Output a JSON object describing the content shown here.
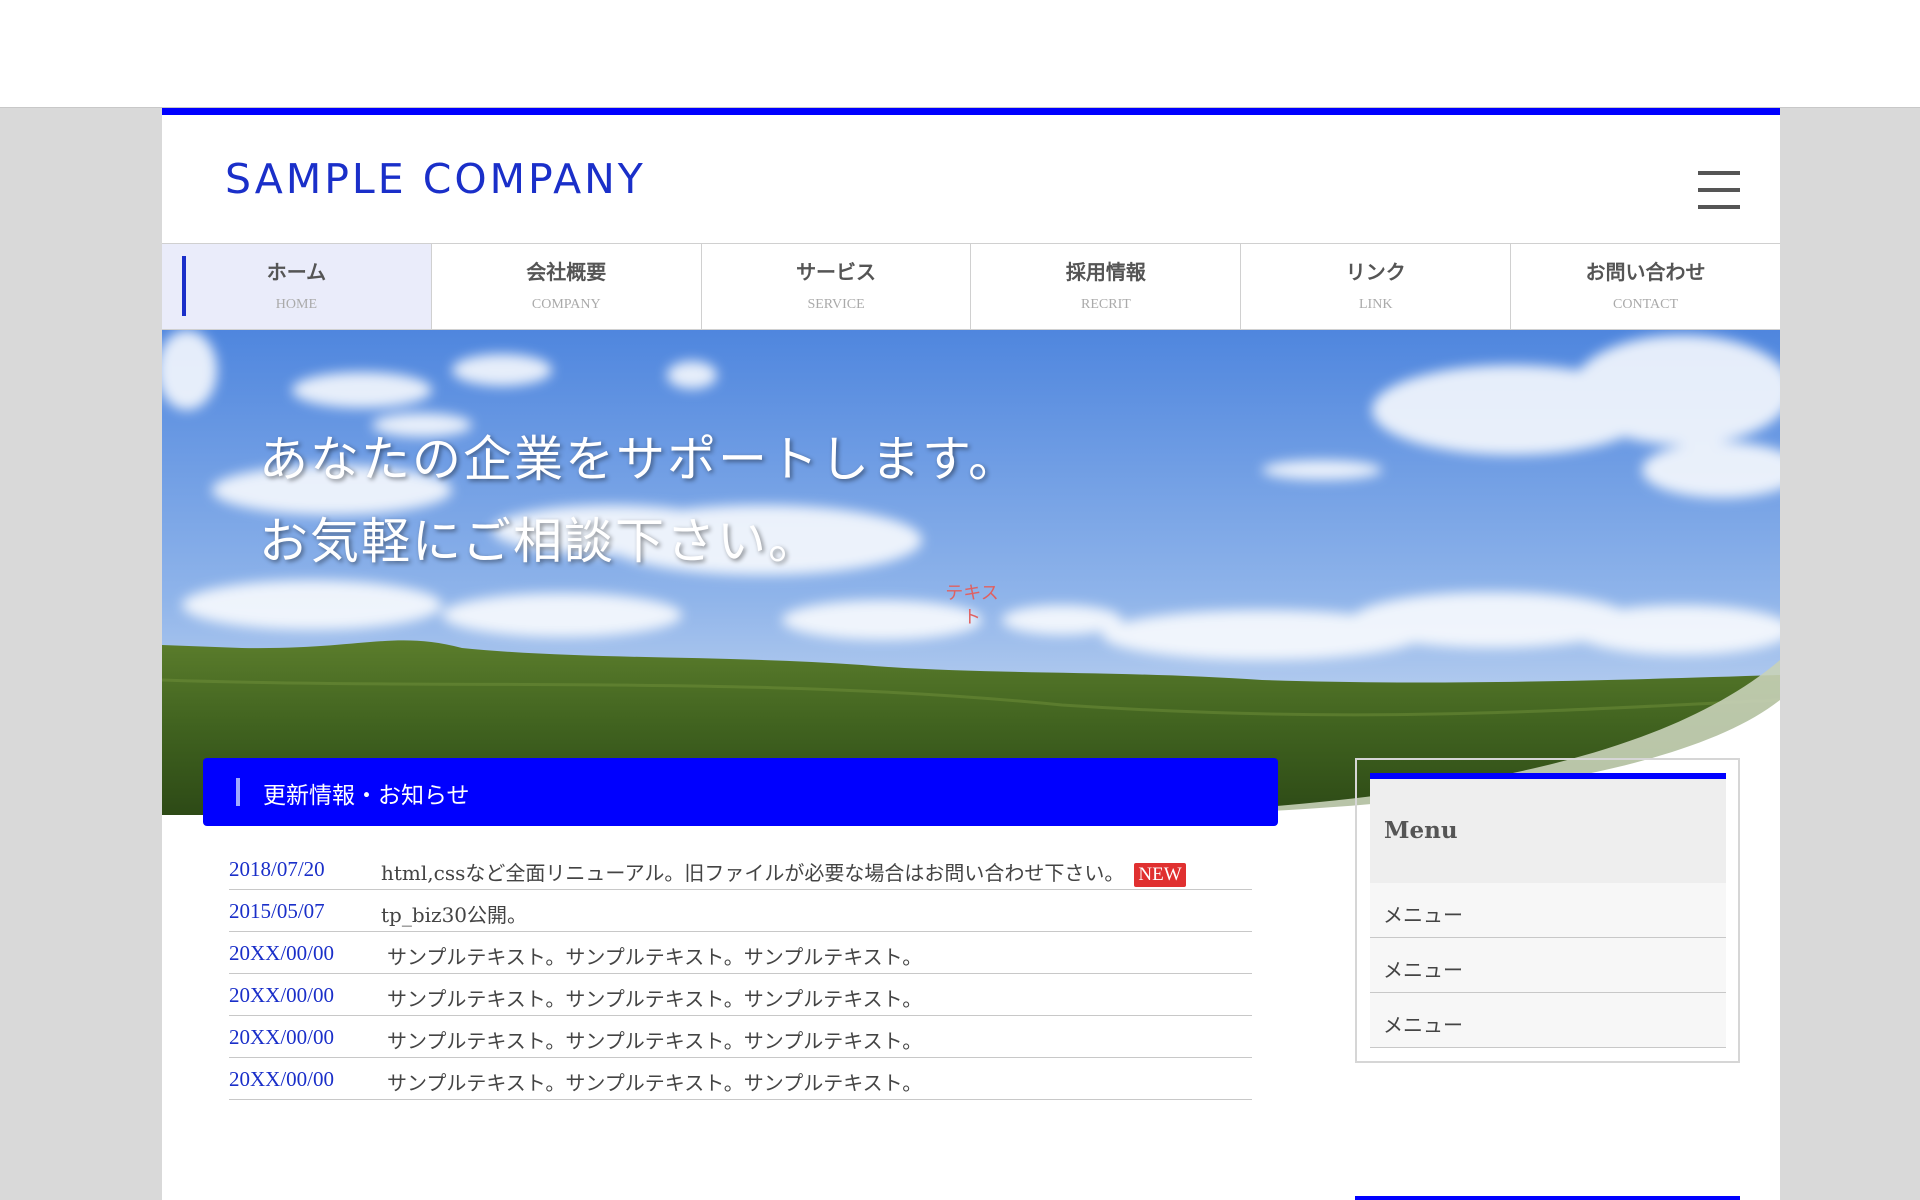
{
  "site": {
    "logo": "SAMPLE COMPANY"
  },
  "colors": {
    "accent": "#0000ff",
    "logo": "#1a2fc9",
    "badge": "#e03030"
  },
  "header": {
    "menu_icon": "hamburger-menu-icon"
  },
  "nav": {
    "items": [
      {
        "label": "ホーム",
        "sub": "HOME"
      },
      {
        "label": "会社概要",
        "sub": "COMPANY"
      },
      {
        "label": "サービス",
        "sub": "SERVICE"
      },
      {
        "label": "採用情報",
        "sub": "RECRIT"
      },
      {
        "label": "リンク",
        "sub": "LINK"
      },
      {
        "label": "お問い合わせ",
        "sub": "CONTACT"
      }
    ]
  },
  "hero": {
    "line1": "あなたの企業をサポートします。",
    "line2": "お気軽にご相談下さい。",
    "tag": "テキスト"
  },
  "news": {
    "heading": "更新情報・お知らせ",
    "badge": "NEW",
    "items": [
      {
        "date": "2018/07/20",
        "text": "html,cssなど全面リニューアル。旧ファイルが必要な場合はお問い合わせ下さい。"
      },
      {
        "date": "2015/05/07",
        "text": "tp_biz30公開。"
      },
      {
        "date": "20XX/00/00",
        "text": "サンプルテキスト。サンプルテキスト。サンプルテキスト。"
      },
      {
        "date": "20XX/00/00",
        "text": "サンプルテキスト。サンプルテキスト。サンプルテキスト。"
      },
      {
        "date": "20XX/00/00",
        "text": "サンプルテキスト。サンプルテキスト。サンプルテキスト。"
      },
      {
        "date": "20XX/00/00",
        "text": "サンプルテキスト。サンプルテキスト。サンプルテキスト。"
      }
    ]
  },
  "sidebar": {
    "title": "Menu",
    "items": [
      "メニュー",
      "メニュー",
      "メニュー"
    ]
  }
}
